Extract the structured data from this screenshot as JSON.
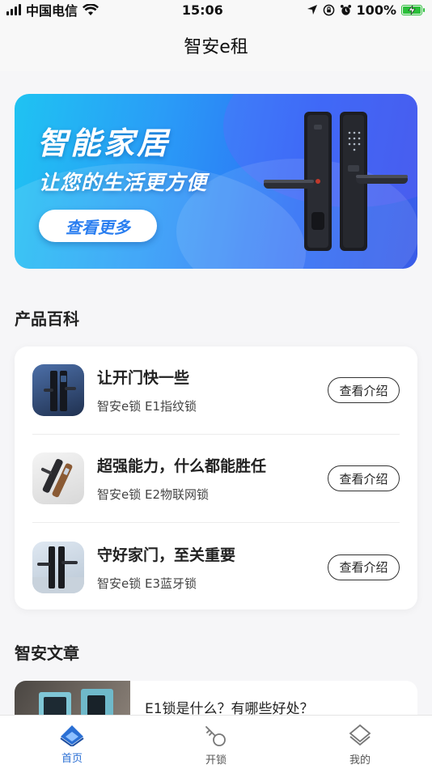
{
  "status_bar": {
    "carrier": "中国电信",
    "time": "15:06",
    "battery": "100%"
  },
  "nav": {
    "title": "智安e租"
  },
  "banner": {
    "title": "智能家居",
    "subtitle": "让您的生活更方便",
    "button_label": "查看更多"
  },
  "products_section": {
    "title": "产品百科",
    "items": [
      {
        "title": "让开门快一些",
        "subtitle": "智安e锁 E1指纹锁",
        "button_label": "查看介绍"
      },
      {
        "title": "超强能力，什么都能胜任",
        "subtitle": "智安e锁 E2物联网锁",
        "button_label": "查看介绍"
      },
      {
        "title": "守好家门，至关重要",
        "subtitle": "智安e锁 E3蓝牙锁",
        "button_label": "查看介绍"
      }
    ]
  },
  "articles_section": {
    "title": "智安文章",
    "items": [
      {
        "title": "E1锁是什么？有哪些好处？"
      }
    ]
  },
  "tabbar": {
    "tabs": [
      {
        "label": "首页",
        "icon": "home-icon",
        "active": true
      },
      {
        "label": "开锁",
        "icon": "key-icon",
        "active": false
      },
      {
        "label": "我的",
        "icon": "profile-icon",
        "active": false
      }
    ]
  },
  "colors": {
    "accent": "#2a6fd4",
    "battery": "#2bbf3a"
  }
}
